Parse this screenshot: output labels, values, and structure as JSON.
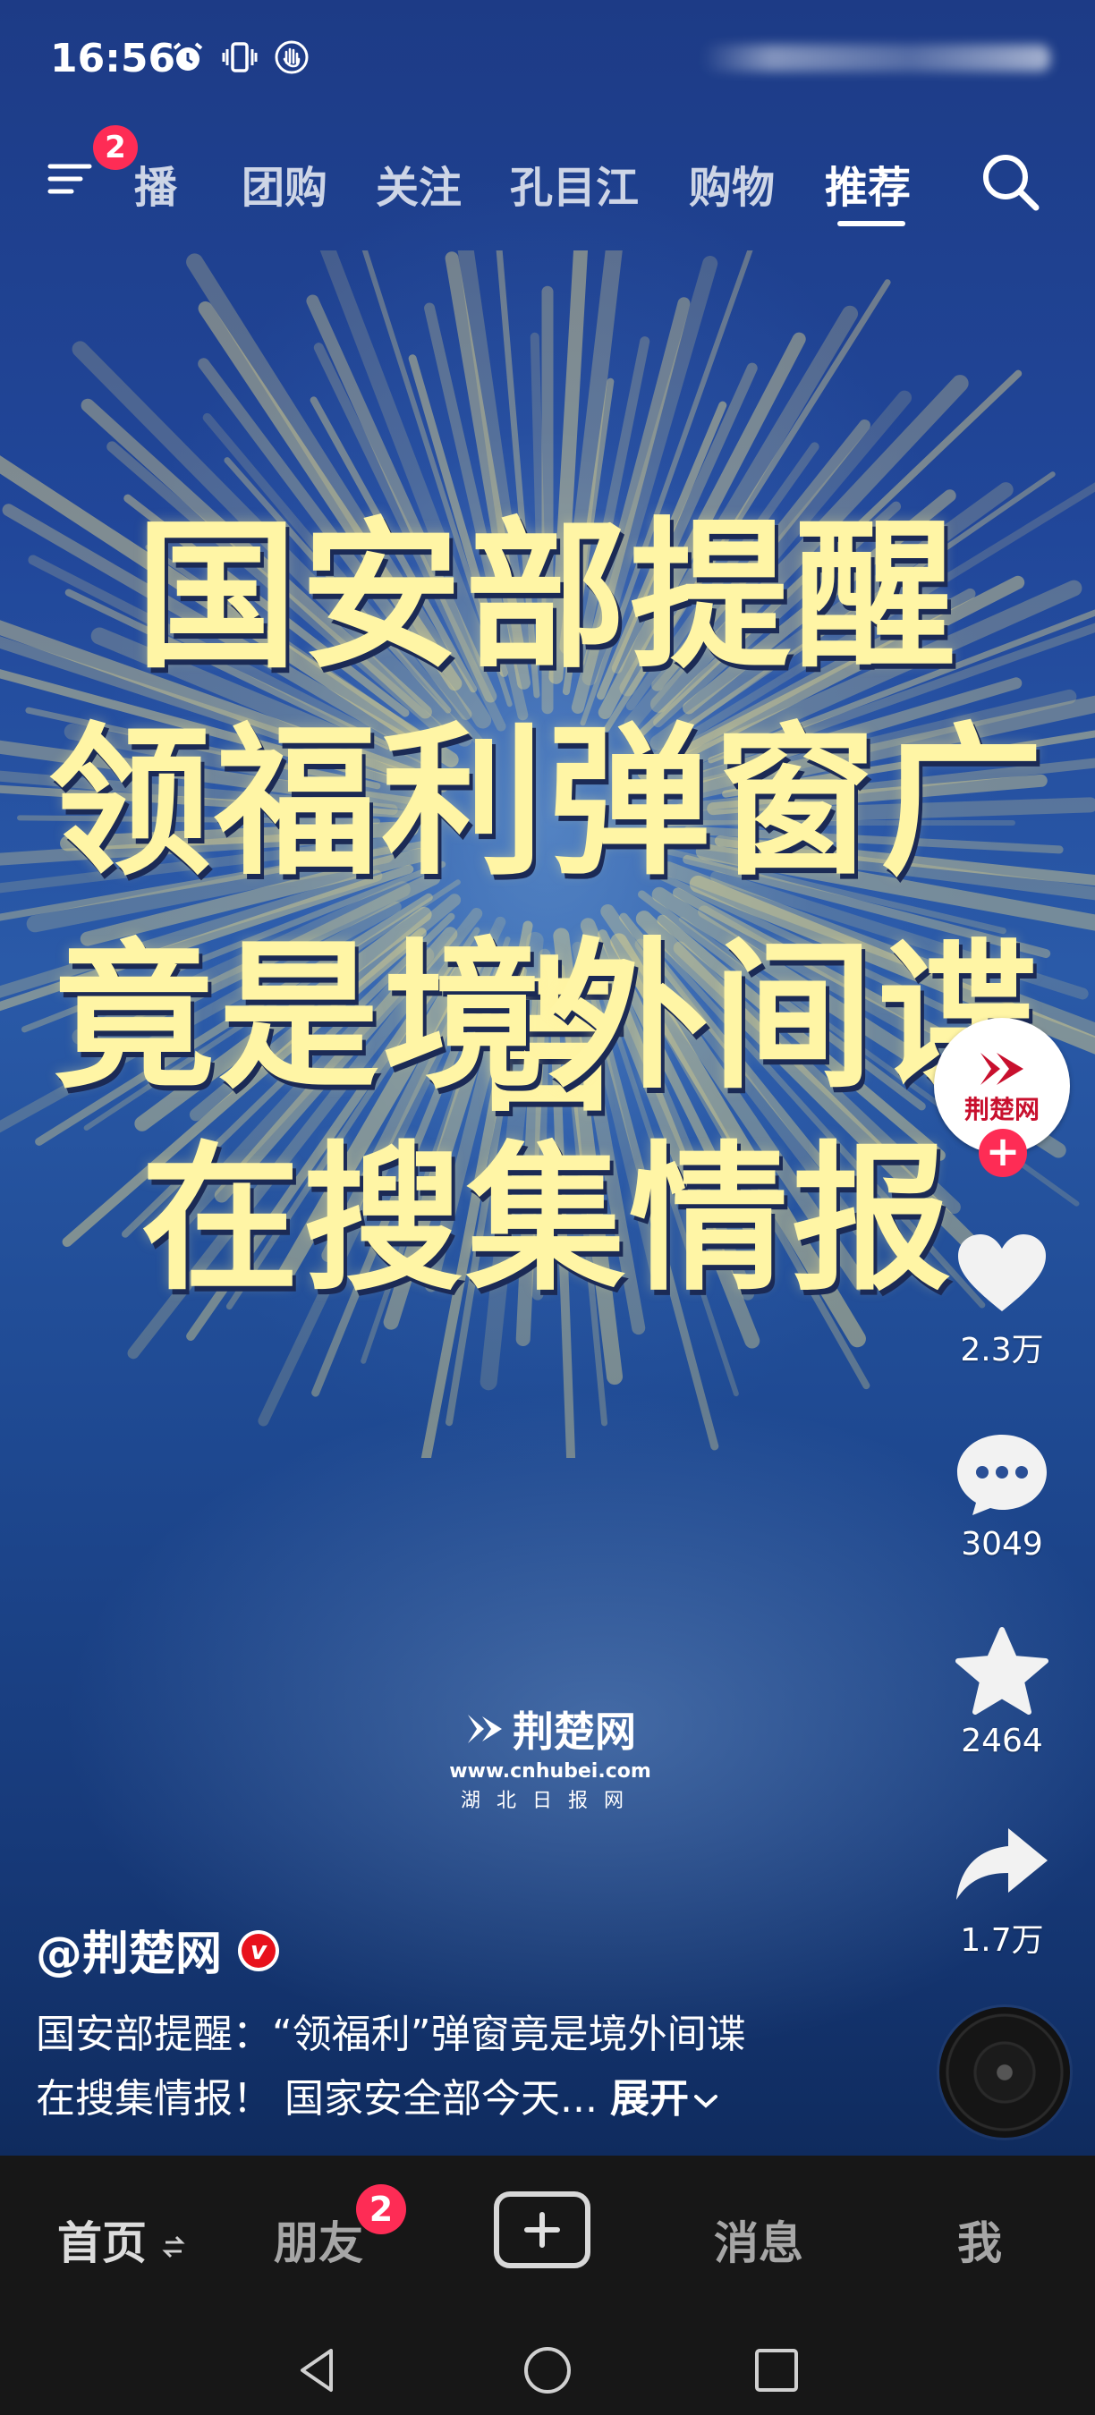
{
  "status_bar": {
    "time": "16:56",
    "icons": [
      "alarm-icon",
      "vibrate-icon",
      "hand-icon"
    ]
  },
  "top_nav": {
    "menu_badge": "2",
    "tabs": [
      {
        "label": "播",
        "active": false
      },
      {
        "label": "团购",
        "active": false
      },
      {
        "label": "关注",
        "active": false
      },
      {
        "label": "孔目江",
        "active": false
      },
      {
        "label": "购物",
        "active": false
      },
      {
        "label": "推荐",
        "active": true
      }
    ]
  },
  "video": {
    "headline_lines": [
      "国安部提醒",
      "领福利弹窗广告",
      "竟是境外间谍",
      "在搜集情报"
    ],
    "watermark": {
      "brand": "荆楚网",
      "url": "www.cnhubei.com",
      "subtitle": "湖北日报网"
    },
    "colors": {
      "headline": "#fff5a5",
      "background": "#21479a",
      "burst": "#e8d98a"
    }
  },
  "right_rail": {
    "avatar_text": "荆楚网",
    "follow_label": "+",
    "likes": "2.3万",
    "comments": "3049",
    "favorites": "2464",
    "shares": "1.7万"
  },
  "caption": {
    "author": "@荆楚网",
    "verified_label": "v",
    "line1": "国安部提醒：“领福利”弹窗竟是境外间谍",
    "line2": "在搜集情报！ 国家安全部今天...",
    "expand_label": "展开"
  },
  "bottom_nav": {
    "home": "首页",
    "friends": "朋友",
    "friends_badge": "2",
    "messages": "消息",
    "me": "我"
  },
  "accent": "#fe2c55"
}
